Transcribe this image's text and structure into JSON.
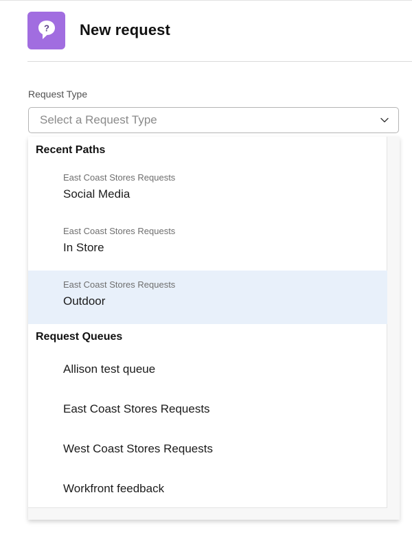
{
  "header": {
    "title": "New request",
    "icon": "question-chat-bubble-icon",
    "icon_color": "#a16de0"
  },
  "form": {
    "request_type_label": "Request Type",
    "request_type_placeholder": "Select a Request Type",
    "dropdown_icon": "chevron-down-icon"
  },
  "dropdown": {
    "recent_heading": "Recent Paths",
    "recent_paths": [
      {
        "parent": "East Coast Stores Requests",
        "name": "Social Media"
      },
      {
        "parent": "East Coast Stores Requests",
        "name": "In Store"
      },
      {
        "parent": "East Coast Stores Requests",
        "name": "Outdoor"
      }
    ],
    "highlighted_index": 2,
    "highlight_color": "#e8f0fa",
    "queues_heading": "Request Queues",
    "queues": [
      {
        "name": "Allison test queue"
      },
      {
        "name": "East Coast Stores Requests"
      },
      {
        "name": "West Coast Stores Requests"
      },
      {
        "name": "Workfront feedback"
      }
    ]
  }
}
